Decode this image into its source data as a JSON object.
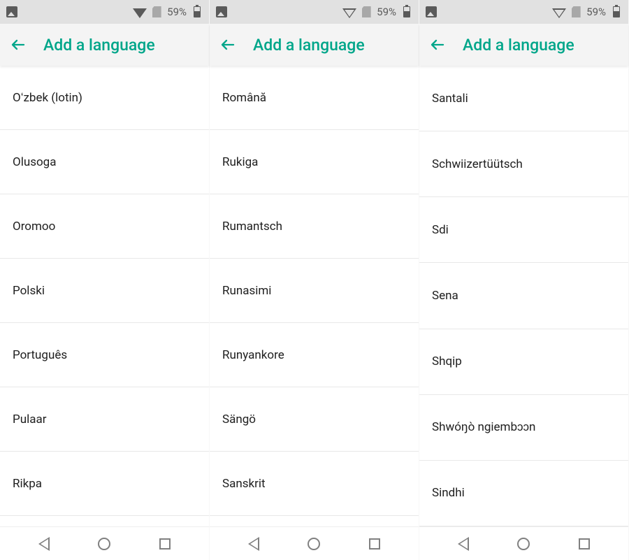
{
  "status": {
    "battery_text": "59%"
  },
  "header": {
    "title": "Add a language"
  },
  "panels": [
    {
      "items": [
        "Oʻzbek (lotin)",
        "Olusoga",
        "Oromoo",
        "Polski",
        "Português",
        "Pulaar",
        "Rikpa"
      ]
    },
    {
      "items": [
        "Română",
        "Rukiga",
        "Rumantsch",
        "Runasimi",
        "Runyankore",
        "Sängö",
        "Sanskrit"
      ]
    },
    {
      "items": [
        "Santali",
        "Schwiizertüütsch",
        "Sdi",
        "Sena",
        "Shqip",
        "Shwóŋò ngiembɔɔn",
        "Sindhi"
      ]
    }
  ]
}
